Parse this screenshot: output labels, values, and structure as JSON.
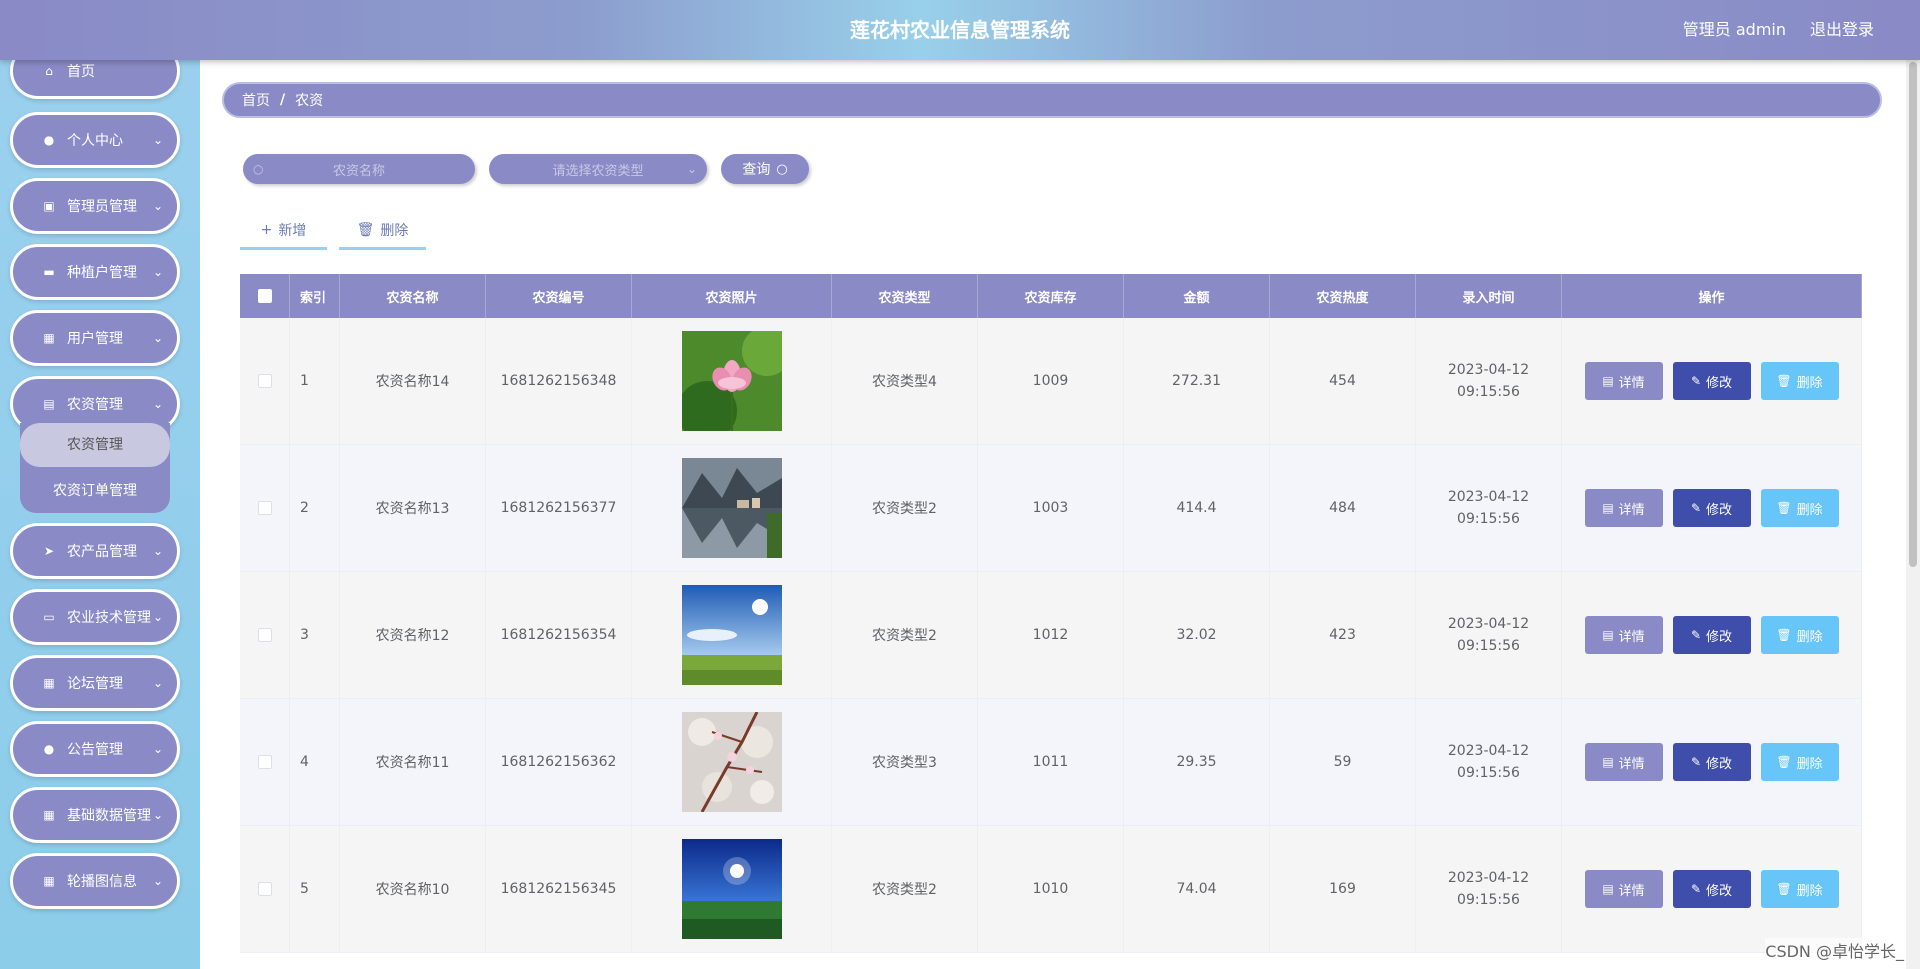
{
  "header": {
    "title": "莲花村农业信息管理系统",
    "user": "管理员 admin",
    "logout": "退出登录"
  },
  "sidebar": {
    "items": [
      {
        "label": "首页",
        "icon": "home-icon"
      },
      {
        "label": "个人中心",
        "icon": "user-icon"
      },
      {
        "label": "管理员管理",
        "icon": "edit-icon"
      },
      {
        "label": "种植户管理",
        "icon": "ticket-icon"
      },
      {
        "label": "用户管理",
        "icon": "grid-icon"
      },
      {
        "label": "农资管理",
        "icon": "suitcase-icon"
      },
      {
        "label": "农产品管理",
        "icon": "send-icon"
      },
      {
        "label": "农业技术管理",
        "icon": "monitor-icon"
      },
      {
        "label": "论坛管理",
        "icon": "grid-icon"
      },
      {
        "label": "公告管理",
        "icon": "user-icon"
      },
      {
        "label": "基础数据管理",
        "icon": "grid-icon"
      },
      {
        "label": "轮播图信息",
        "icon": "grid-icon"
      }
    ],
    "submenu": [
      {
        "label": "农资管理"
      },
      {
        "label": "农资订单管理"
      }
    ]
  },
  "breadcrumb": {
    "home": "首页",
    "separator": "/",
    "current": "农资"
  },
  "search": {
    "name_placeholder": "农资名称",
    "type_placeholder": "请选择农资类型",
    "query_label": "查询"
  },
  "actions": {
    "add_label": "新增",
    "delete_label": "删除"
  },
  "table": {
    "headers": [
      "索引",
      "农资名称",
      "农资编号",
      "农资照片",
      "农资类型",
      "农资库存",
      "金额",
      "农资热度",
      "录入时间",
      "操作"
    ],
    "op_labels": {
      "detail": "详情",
      "edit": "修改",
      "delete": "删除"
    },
    "rows": [
      {
        "index": "1",
        "name": "农资名称14",
        "code": "1681262156348",
        "photo": "lotus-photo",
        "type": "农资类型4",
        "stock": "1009",
        "amount": "272.31",
        "heat": "454",
        "time": "2023-04-12 09:15:56"
      },
      {
        "index": "2",
        "name": "农资名称13",
        "code": "1681262156377",
        "photo": "lake-town-photo",
        "type": "农资类型2",
        "stock": "1003",
        "amount": "414.4",
        "heat": "484",
        "time": "2023-04-12 09:15:56"
      },
      {
        "index": "3",
        "name": "农资名称12",
        "code": "1681262156354",
        "photo": "sky-field-photo",
        "type": "农资类型2",
        "stock": "1012",
        "amount": "32.02",
        "heat": "423",
        "time": "2023-04-12 09:15:56"
      },
      {
        "index": "4",
        "name": "农资名称11",
        "code": "1681262156362",
        "photo": "blossom-photo",
        "type": "农资类型3",
        "stock": "1011",
        "amount": "29.35",
        "heat": "59",
        "time": "2023-04-12 09:15:56"
      },
      {
        "index": "5",
        "name": "农资名称10",
        "code": "1681262156345",
        "photo": "night-field-photo",
        "type": "农资类型2",
        "stock": "1010",
        "amount": "74.04",
        "heat": "169",
        "time": "2023-04-12 09:15:56"
      }
    ]
  },
  "watermark": "CSDN @卓怡学长_"
}
